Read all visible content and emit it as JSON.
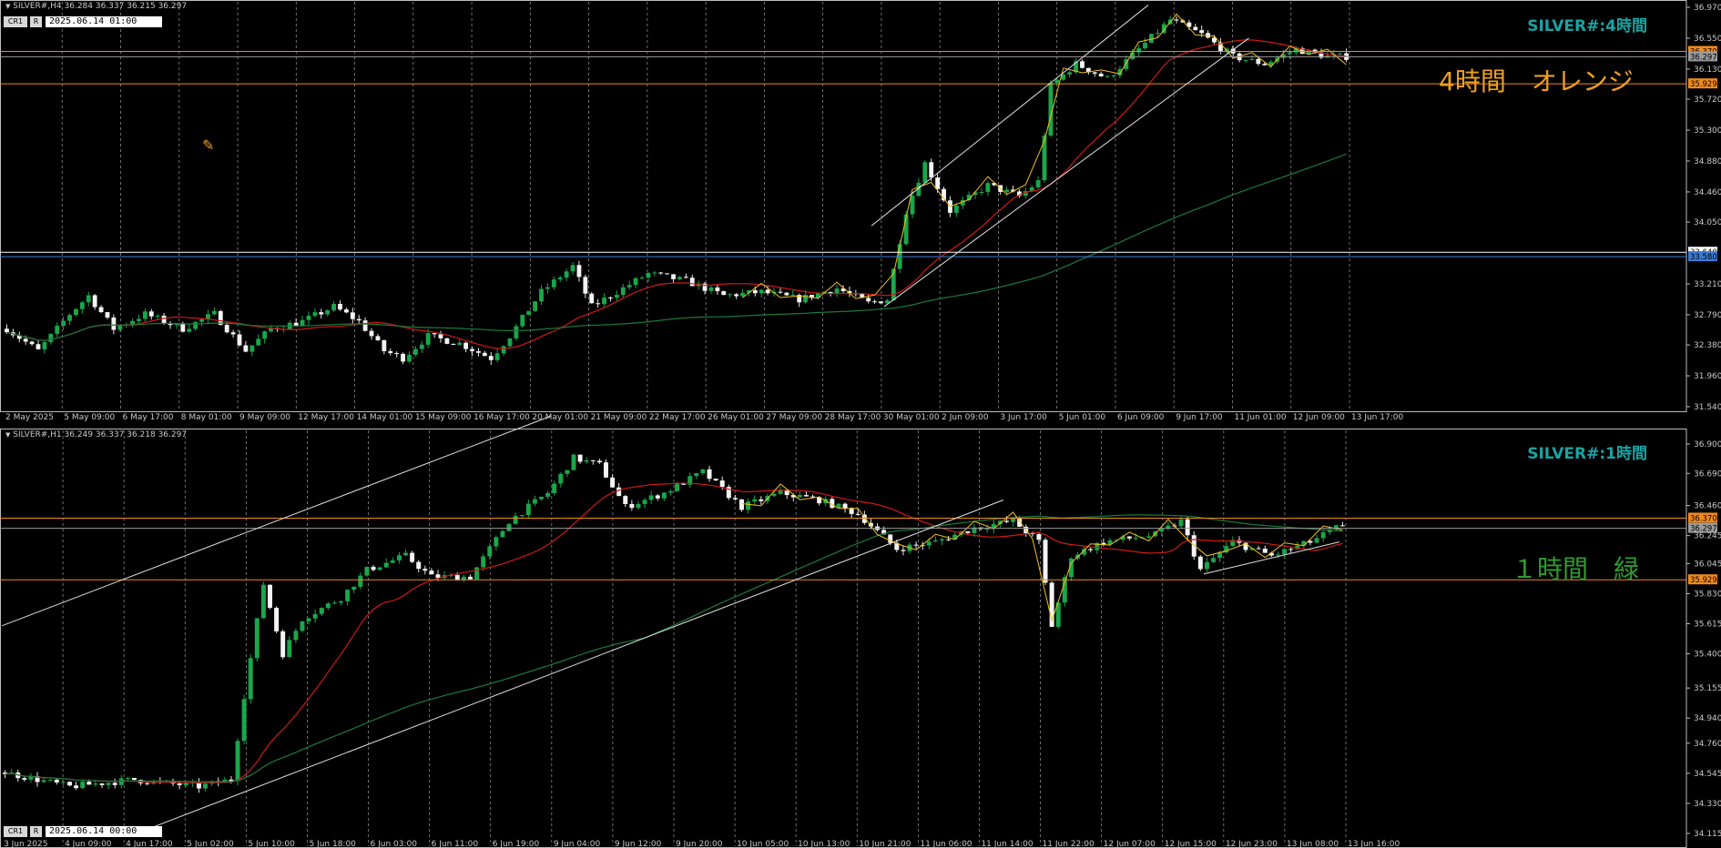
{
  "panels": [
    {
      "id": "h4",
      "header": "SILVER#,H4  36.284 36.337 36.215 36.297",
      "cr1_label": "CR1",
      "r_label": "R",
      "date_box": "2025.06.14 01:00",
      "title": "SILVER#:4時間",
      "annotation": "4時間　オレンジ",
      "annotation_color": "#f0a020",
      "title_color": "#1aa3a3"
    },
    {
      "id": "h1",
      "header": "SILVER#,H1  36.249 36.337 36.218 36.297",
      "cr1_label": "CR1",
      "r_label": "R",
      "date_box": "2025.06.14 00:00",
      "title": "SILVER#:1時間",
      "annotation": "１時間　緑",
      "annotation_color": "#2e9e2e",
      "title_color": "#1aa3a3"
    }
  ],
  "chart_data": [
    {
      "type": "candlestick",
      "title": "SILVER#:4時間",
      "ylim": [
        31.54,
        36.97
      ],
      "y_ticks": [
        "36.970",
        "36.550",
        "36.130",
        "35.720",
        "35.300",
        "34.880",
        "34.460",
        "34.050",
        "33.210",
        "32.790",
        "32.380",
        "31.960",
        "31.540"
      ],
      "x_ticks": [
        "2 May 2025",
        "5 May 09:00",
        "6 May 17:00",
        "8 May 01:00",
        "9 May 09:00",
        "12 May 17:00",
        "14 May 01:00",
        "15 May 09:00",
        "16 May 17:00",
        "20 May 01:00",
        "21 May 09:00",
        "22 May 17:00",
        "26 May 01:00",
        "27 May 09:00",
        "28 May 17:00",
        "30 May 01:00",
        "2 Jun 09:00",
        "3 Jun 17:00",
        "5 Jun 01:00",
        "6 Jun 09:00",
        "9 Jun 17:00",
        "11 Jun 01:00",
        "12 Jun 09:00",
        "13 Jun 17:00"
      ],
      "levels": [
        {
          "value": 36.37,
          "label": "36.370",
          "color": "#f08a1c"
        },
        {
          "value": 36.297,
          "label": "36.297",
          "color": "#9a9a9a"
        },
        {
          "value": 35.929,
          "label": "35.929",
          "color": "#f08a1c"
        },
        {
          "value": 33.64,
          "label": "33.640",
          "color": "#ffffff"
        },
        {
          "value": 33.58,
          "label": "33.580",
          "color": "#3a7bd5"
        }
      ],
      "anchors": [
        [
          0,
          32.6
        ],
        [
          5,
          32.3
        ],
        [
          10,
          32.8
        ],
        [
          13,
          33.05
        ],
        [
          17,
          32.6
        ],
        [
          22,
          32.8
        ],
        [
          28,
          32.6
        ],
        [
          33,
          32.8
        ],
        [
          38,
          32.3
        ],
        [
          42,
          32.6
        ],
        [
          47,
          32.7
        ],
        [
          52,
          32.9
        ],
        [
          56,
          32.7
        ],
        [
          60,
          32.3
        ],
        [
          63,
          32.2
        ],
        [
          67,
          32.5
        ],
        [
          72,
          32.4
        ],
        [
          77,
          32.2
        ],
        [
          80,
          32.5
        ],
        [
          85,
          33.1
        ],
        [
          90,
          33.45
        ],
        [
          93,
          32.9
        ],
        [
          97,
          33.1
        ],
        [
          102,
          33.35
        ],
        [
          108,
          33.25
        ],
        [
          114,
          33.05
        ],
        [
          120,
          33.1
        ],
        [
          126,
          33.0
        ],
        [
          132,
          33.15
        ],
        [
          137,
          32.95
        ],
        [
          140,
          33.0
        ],
        [
          143,
          34.2
        ],
        [
          146,
          34.85
        ],
        [
          150,
          34.2
        ],
        [
          156,
          34.55
        ],
        [
          161,
          34.4
        ],
        [
          164,
          34.6
        ],
        [
          166,
          35.9
        ],
        [
          170,
          36.2
        ],
        [
          175,
          36.0
        ],
        [
          180,
          36.4
        ],
        [
          185,
          36.8
        ],
        [
          190,
          36.6
        ],
        [
          195,
          36.3
        ],
        [
          200,
          36.2
        ],
        [
          205,
          36.4
        ],
        [
          210,
          36.3
        ],
        [
          213,
          36.3
        ]
      ],
      "n_candles": 214,
      "ma_colors": {
        "ma20": "#d01818",
        "ma100": "#1c7a3c"
      }
    },
    {
      "type": "candlestick",
      "title": "SILVER#:1時間",
      "ylim": [
        34.115,
        36.9
      ],
      "y_ticks": [
        "36.900",
        "36.690",
        "36.460",
        "36.245",
        "36.045",
        "35.830",
        "35.615",
        "35.400",
        "35.155",
        "34.940",
        "34.760",
        "34.545",
        "34.330",
        "34.115"
      ],
      "x_ticks": [
        "3 Jun 2025",
        "4 Jun 09:00",
        "4 Jun 17:00",
        "5 Jun 02:00",
        "5 Jun 10:00",
        "5 Jun 18:00",
        "6 Jun 03:00",
        "6 Jun 11:00",
        "6 Jun 19:00",
        "9 Jun 04:00",
        "9 Jun 12:00",
        "9 Jun 20:00",
        "10 Jun 05:00",
        "10 Jun 13:00",
        "10 Jun 21:00",
        "11 Jun 06:00",
        "11 Jun 14:00",
        "11 Jun 22:00",
        "12 Jun 07:00",
        "12 Jun 15:00",
        "12 Jun 23:00",
        "13 Jun 08:00",
        "13 Jun 16:00"
      ],
      "levels": [
        {
          "value": 36.37,
          "label": "36.370",
          "color": "#f08a1c"
        },
        {
          "value": 36.297,
          "label": "36.297",
          "color": "#9a9a9a"
        },
        {
          "value": 35.929,
          "label": "35.929",
          "color": "#f08a1c"
        }
      ],
      "anchors": [
        [
          0,
          34.55
        ],
        [
          10,
          34.45
        ],
        [
          20,
          34.5
        ],
        [
          30,
          34.45
        ],
        [
          35,
          34.5
        ],
        [
          37,
          35.1
        ],
        [
          40,
          35.9
        ],
        [
          43,
          35.4
        ],
        [
          46,
          35.65
        ],
        [
          52,
          35.8
        ],
        [
          56,
          36.0
        ],
        [
          62,
          36.1
        ],
        [
          66,
          35.95
        ],
        [
          72,
          35.95
        ],
        [
          78,
          36.35
        ],
        [
          84,
          36.55
        ],
        [
          88,
          36.8
        ],
        [
          92,
          36.75
        ],
        [
          96,
          36.45
        ],
        [
          102,
          36.55
        ],
        [
          108,
          36.7
        ],
        [
          114,
          36.45
        ],
        [
          120,
          36.55
        ],
        [
          126,
          36.5
        ],
        [
          132,
          36.4
        ],
        [
          138,
          36.15
        ],
        [
          144,
          36.2
        ],
        [
          150,
          36.3
        ],
        [
          156,
          36.35
        ],
        [
          160,
          36.2
        ],
        [
          162,
          35.6
        ],
        [
          165,
          36.1
        ],
        [
          170,
          36.2
        ],
        [
          178,
          36.25
        ],
        [
          182,
          36.35
        ],
        [
          185,
          36.0
        ],
        [
          190,
          36.2
        ],
        [
          196,
          36.1
        ],
        [
          202,
          36.2
        ],
        [
          206,
          36.3
        ],
        [
          207,
          36.3
        ]
      ],
      "n_candles": 208,
      "ma_colors": {
        "ma20": "#d01818",
        "ma100": "#1c7a3c"
      }
    }
  ]
}
